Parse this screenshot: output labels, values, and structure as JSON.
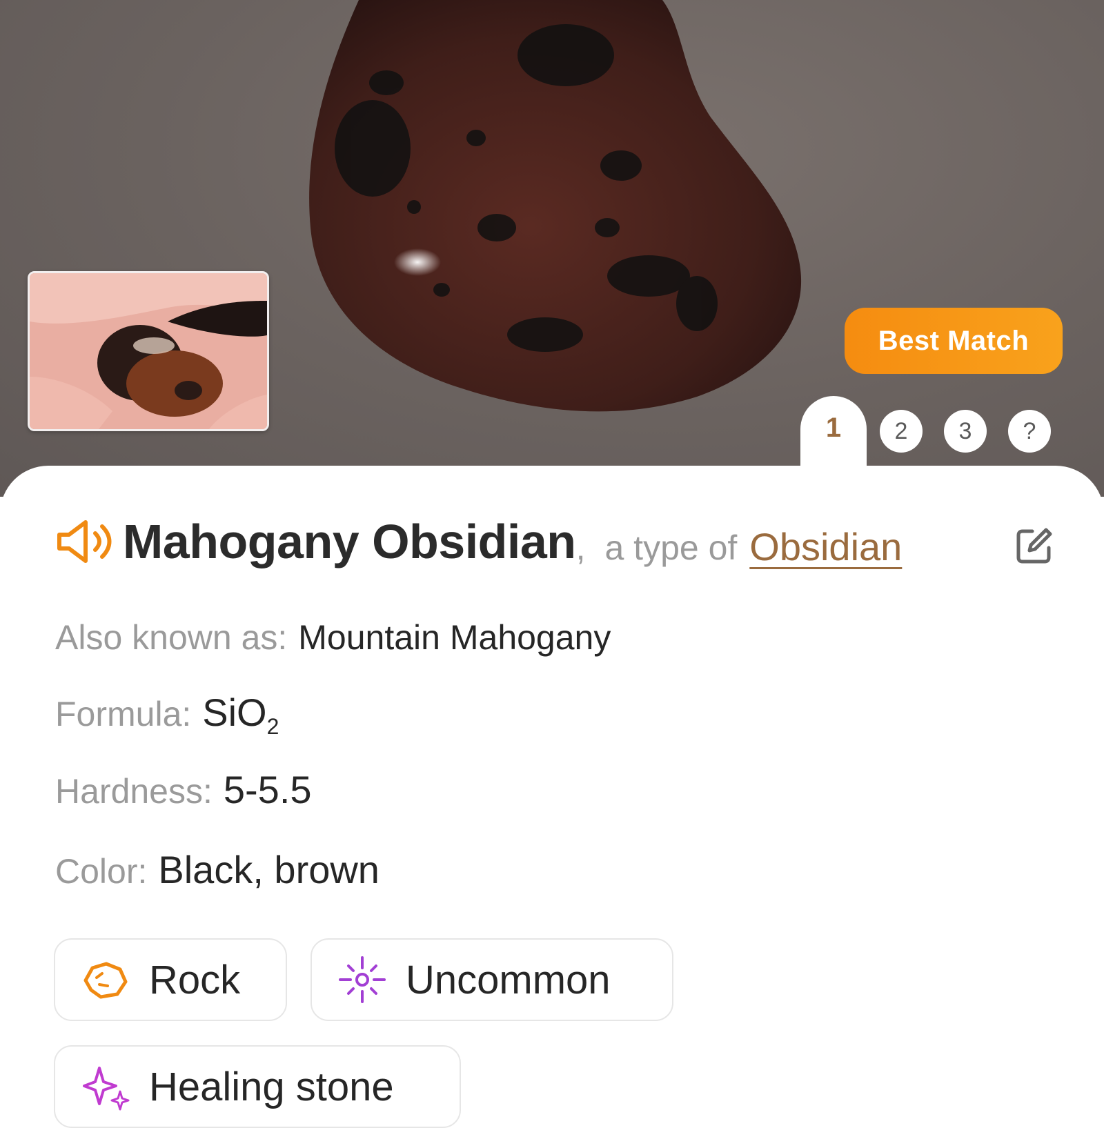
{
  "hero": {
    "badge": "Best Match",
    "active_tab": "1",
    "tabs": [
      "2",
      "3",
      "?"
    ]
  },
  "title": {
    "name": "Mahogany Obsidian",
    "separator": ",",
    "type_prefix": "a type of",
    "type_link": "Obsidian"
  },
  "details": {
    "aka_label": "Also known as:",
    "aka_value": "Mountain Mahogany",
    "formula_label": "Formula:",
    "formula_base": "SiO",
    "formula_sub": "2",
    "hardness_label": "Hardness:",
    "hardness_value": "5-5.5",
    "color_label": "Color:",
    "color_value": "Black, brown"
  },
  "chips": [
    {
      "label": "Rock",
      "icon": "rock-icon",
      "color": "#f08a12"
    },
    {
      "label": "Uncommon",
      "icon": "sparkle-icon",
      "color": "#a23fd4"
    },
    {
      "label": "Healing stone",
      "icon": "stars-icon",
      "color": "#c03bd0"
    }
  ],
  "colors": {
    "accent_orange": "#f58c10",
    "link_brown": "#9a6b3e"
  }
}
